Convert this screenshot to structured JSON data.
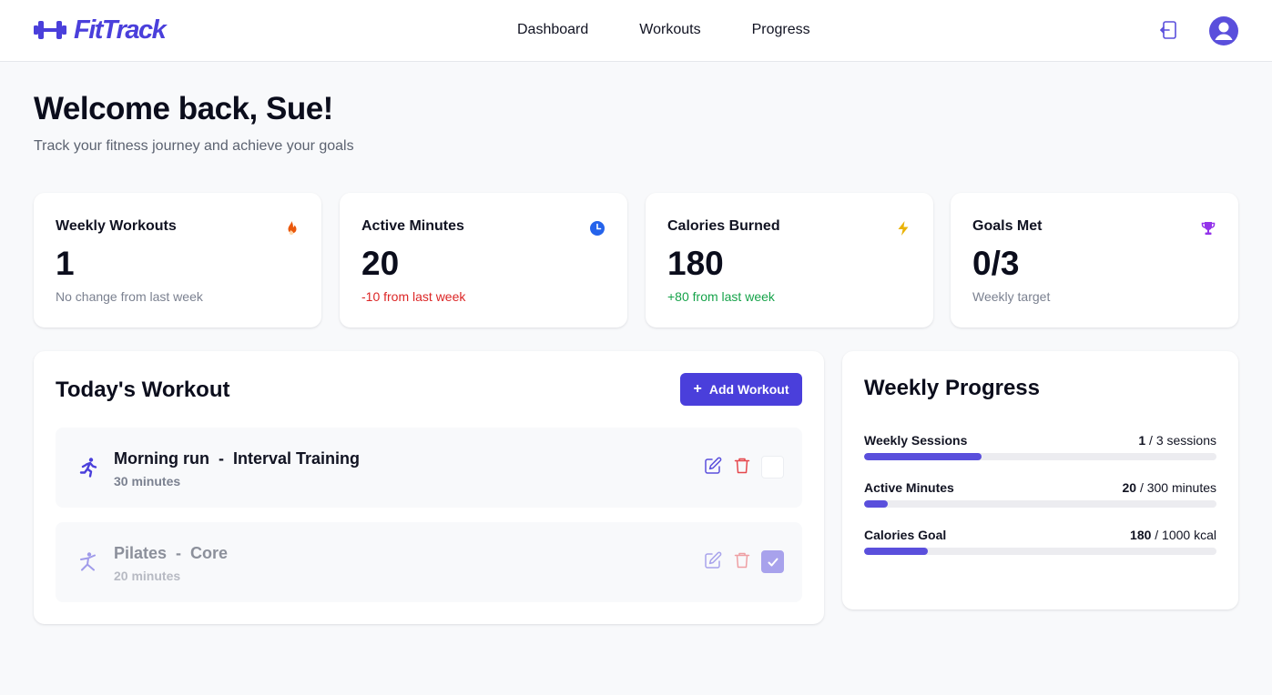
{
  "header": {
    "logo_text": "FitTrack",
    "nav": [
      "Dashboard",
      "Workouts",
      "Progress"
    ],
    "colors": {
      "brand": "#4a3fdb"
    },
    "icons": {
      "logo": "dumbbell-icon",
      "logout": "logout-icon",
      "profile": "user-circle-icon"
    }
  },
  "welcome": {
    "title": "Welcome back, Sue!",
    "subtitle": "Track your fitness journey and achieve your goals"
  },
  "stats": [
    {
      "label": "Weekly Workouts",
      "value": "1",
      "note": "No change from last week",
      "icon": "flame-icon",
      "icon_color": "#ea580c"
    },
    {
      "label": "Active Minutes",
      "value": "20",
      "note": "-10 from last week",
      "icon": "clock-icon",
      "icon_color": "#2563eb"
    },
    {
      "label": "Calories Burned",
      "value": "180",
      "note": "+80 from last week",
      "icon": "bolt-icon",
      "icon_color": "#eab308"
    },
    {
      "label": "Goals Met",
      "value": "0/3",
      "note": "Weekly target",
      "icon": "trophy-icon",
      "icon_color": "#9333ea"
    }
  ],
  "today": {
    "title": "Today's Workout",
    "add_button": "Add Workout",
    "workouts": [
      {
        "name": "Morning run  -  Interval Training",
        "duration": "30 minutes",
        "completed": false,
        "icon": "running-icon"
      },
      {
        "name": "Pilates  -  Core",
        "duration": "20 minutes",
        "completed": true,
        "icon": "pilates-icon"
      }
    ]
  },
  "weekly_progress": {
    "title": "Weekly Progress",
    "items": [
      {
        "label": "Weekly Sessions",
        "current": "1",
        "rest": " / 3 sessions",
        "fraction": 0.333
      },
      {
        "label": "Active Minutes",
        "current": "20",
        "rest": " / 300 minutes",
        "fraction": 0.067
      },
      {
        "label": "Calories Goal",
        "current": "180",
        "rest": " / 1000 kcal",
        "fraction": 0.18
      }
    ]
  }
}
